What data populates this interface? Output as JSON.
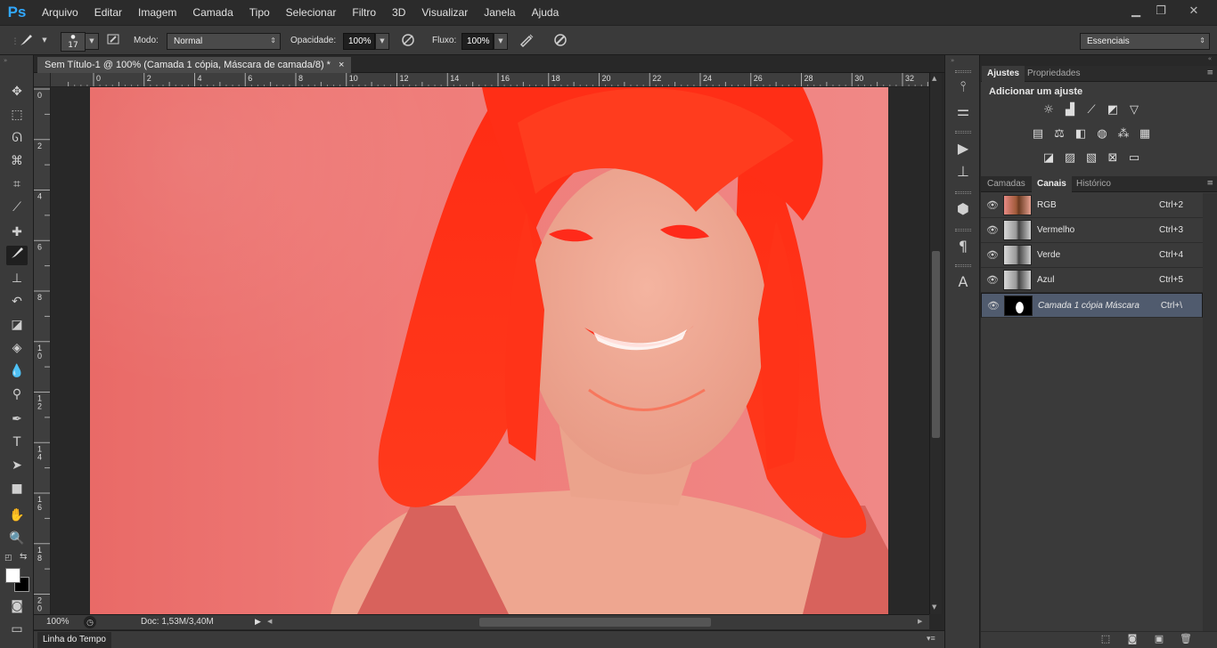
{
  "app": {
    "logo": "Ps"
  },
  "menu": [
    "Arquivo",
    "Editar",
    "Imagem",
    "Camada",
    "Tipo",
    "Selecionar",
    "Filtro",
    "3D",
    "Visualizar",
    "Janela",
    "Ajuda"
  ],
  "window_controls": {
    "minimize": "▁",
    "restore": "❐",
    "close": "✕"
  },
  "options": {
    "brush_size": "17",
    "mode_label": "Modo:",
    "mode_value": "Normal",
    "opacity_label": "Opacidade:",
    "opacity_value": "100%",
    "flow_label": "Fluxo:",
    "flow_value": "100%",
    "workspace": "Essenciais"
  },
  "document": {
    "tab_title": "Sem Título-1 @ 100% (Camada 1 cópia, Máscara de camada/8) *",
    "close": "×",
    "zoom": "100%",
    "doc_info": "Doc: 1,53M/3,40M"
  },
  "ruler_top": [
    "0",
    "2",
    "4",
    "6",
    "8",
    "10",
    "12",
    "14",
    "16",
    "18",
    "20",
    "22",
    "24",
    "26",
    "28",
    "30",
    "32"
  ],
  "ruler_left": [
    "0",
    "2",
    "4",
    "6",
    "8",
    "1\n0",
    "1\n2",
    "1\n4",
    "1\n6",
    "1\n8",
    "2\n0"
  ],
  "timeline_label": "Linha do Tempo",
  "adjust_panel": {
    "tabs": [
      "Ajustes",
      "Propriedades"
    ],
    "heading": "Adicionar um ajuste"
  },
  "channels_panel": {
    "tabs": [
      "Camadas",
      "Canais",
      "Histórico"
    ],
    "channels": [
      {
        "name": "RGB",
        "shortcut": "Ctrl+2"
      },
      {
        "name": "Vermelho",
        "shortcut": "Ctrl+3"
      },
      {
        "name": "Verde",
        "shortcut": "Ctrl+4"
      },
      {
        "name": "Azul",
        "shortcut": "Ctrl+5"
      },
      {
        "name": "Camada 1 cópia Máscara",
        "shortcut": "Ctrl+\\"
      }
    ]
  },
  "colors": {
    "accent": "#31a8ff",
    "selected_row": "#505b6e",
    "mask_overlay": "#ff2a1a"
  }
}
